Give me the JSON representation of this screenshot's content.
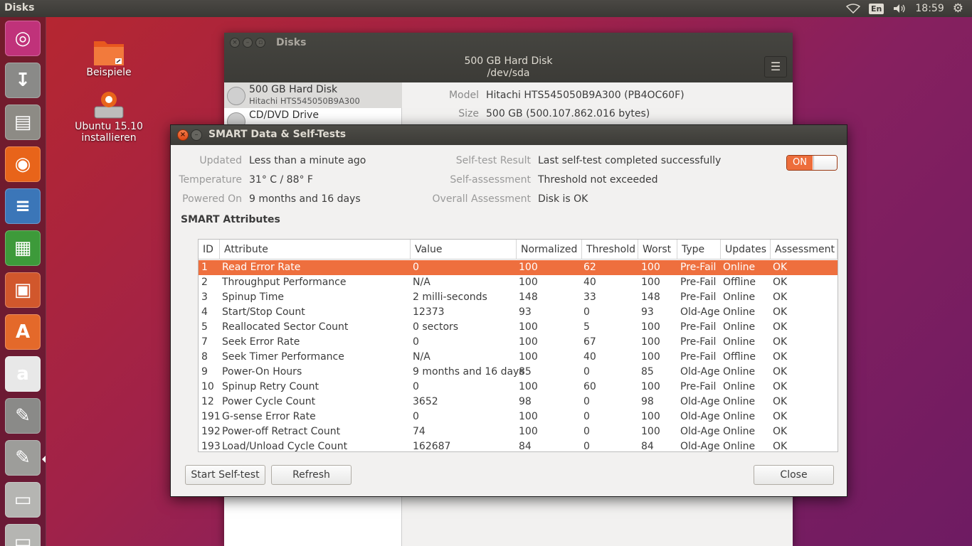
{
  "top_panel": {
    "app_title": "Disks",
    "keyboard_layout": "En",
    "clock": "18:59",
    "icons": [
      "wifi-icon",
      "keyboard-layout-indicator",
      "volume-icon",
      "settings-gear-icon"
    ]
  },
  "launcher": {
    "items": [
      {
        "name": "ubuntu-dash-icon",
        "glyph": "◎",
        "color": "#c0327a"
      },
      {
        "name": "ubuntu-installer-icon",
        "glyph": "↧",
        "color": "#8a8a88"
      },
      {
        "name": "files-icon",
        "glyph": "▤",
        "color": "#8d8b85"
      },
      {
        "name": "firefox-icon",
        "glyph": "◉",
        "color": "#e8641a"
      },
      {
        "name": "libreoffice-writer-icon",
        "glyph": "≡",
        "color": "#3b76b8"
      },
      {
        "name": "libreoffice-calc-icon",
        "glyph": "▦",
        "color": "#3d9a3a"
      },
      {
        "name": "libreoffice-impress-icon",
        "glyph": "▣",
        "color": "#d1572c"
      },
      {
        "name": "software-center-icon",
        "glyph": "A",
        "color": "#e4692a"
      },
      {
        "name": "amazon-icon",
        "glyph": "a",
        "color": "#e8e8e8"
      },
      {
        "name": "system-settings-icon",
        "glyph": "✎",
        "color": "#8a8a88"
      },
      {
        "name": "disks-app-icon",
        "glyph": "✎",
        "color": "#9d9d9a"
      },
      {
        "name": "drive-icon",
        "glyph": "▭",
        "color": "#b5b5b2"
      },
      {
        "name": "drive-icon-2",
        "glyph": "▭",
        "color": "#b5b5b2"
      }
    ]
  },
  "desktop": {
    "icons": [
      {
        "label": "Beispiele"
      },
      {
        "label": "Ubuntu 15.10 installieren"
      }
    ]
  },
  "disks_window": {
    "title": "Disks",
    "subtitle": "500 GB Hard Disk",
    "device_path": "/dev/sda",
    "devices": [
      {
        "name": "500 GB Hard Disk",
        "sub": "Hitachi HTS545050B9A300"
      },
      {
        "name": "CD/DVD Drive",
        "sub": ""
      }
    ],
    "details": [
      {
        "label": "Model",
        "value": "Hitachi HTS545050B9A300 (PB4OC60F)"
      },
      {
        "label": "Size",
        "value": "500 GB (500.107.862.016 bytes)"
      }
    ]
  },
  "smart_dialog": {
    "title": "SMART Data & Self-Tests",
    "info_left": [
      {
        "label": "Updated",
        "value": "Less than a minute ago"
      },
      {
        "label": "Temperature",
        "value": "31° C / 88° F"
      },
      {
        "label": "Powered On",
        "value": "9 months and 16 days"
      }
    ],
    "info_right": [
      {
        "label": "Self-test Result",
        "value": "Last self-test completed successfully"
      },
      {
        "label": "Self-assessment",
        "value": "Threshold not exceeded"
      },
      {
        "label": "Overall Assessment",
        "value": "Disk is OK"
      }
    ],
    "toggle_label": "ON",
    "toggle_state": "on",
    "section_title": "SMART Attributes",
    "columns": [
      "ID",
      "Attribute",
      "Value",
      "Normalized",
      "Threshold",
      "Worst",
      "Type",
      "Updates",
      "Assessment"
    ],
    "rows": [
      [
        "1",
        "Read Error Rate",
        "0",
        "100",
        "62",
        "100",
        "Pre-Fail",
        "Online",
        "OK"
      ],
      [
        "2",
        "Throughput Performance",
        "N/A",
        "100",
        "40",
        "100",
        "Pre-Fail",
        "Offline",
        "OK"
      ],
      [
        "3",
        "Spinup Time",
        "2 milli-seconds",
        "148",
        "33",
        "148",
        "Pre-Fail",
        "Online",
        "OK"
      ],
      [
        "4",
        "Start/Stop Count",
        "12373",
        "93",
        "0",
        "93",
        "Old-Age",
        "Online",
        "OK"
      ],
      [
        "5",
        "Reallocated Sector Count",
        "0 sectors",
        "100",
        "5",
        "100",
        "Pre-Fail",
        "Online",
        "OK"
      ],
      [
        "7",
        "Seek Error Rate",
        "0",
        "100",
        "67",
        "100",
        "Pre-Fail",
        "Online",
        "OK"
      ],
      [
        "8",
        "Seek Timer Performance",
        "N/A",
        "100",
        "40",
        "100",
        "Pre-Fail",
        "Offline",
        "OK"
      ],
      [
        "9",
        "Power-On Hours",
        "9 months and 16 days",
        "85",
        "0",
        "85",
        "Old-Age",
        "Online",
        "OK"
      ],
      [
        "10",
        "Spinup Retry Count",
        "0",
        "100",
        "60",
        "100",
        "Pre-Fail",
        "Online",
        "OK"
      ],
      [
        "12",
        "Power Cycle Count",
        "3652",
        "98",
        "0",
        "98",
        "Old-Age",
        "Online",
        "OK"
      ],
      [
        "191",
        "G-sense Error Rate",
        "0",
        "100",
        "0",
        "100",
        "Old-Age",
        "Online",
        "OK"
      ],
      [
        "192",
        "Power-off Retract Count",
        "74",
        "100",
        "0",
        "100",
        "Old-Age",
        "Online",
        "OK"
      ],
      [
        "193",
        "Load/Unload Cycle Count",
        "162687",
        "84",
        "0",
        "84",
        "Old-Age",
        "Online",
        "OK"
      ]
    ],
    "selected_row": 0,
    "accent_color": "#ee6f3e",
    "buttons": {
      "start_self_test": "Start Self-test",
      "refresh": "Refresh",
      "close": "Close"
    }
  }
}
